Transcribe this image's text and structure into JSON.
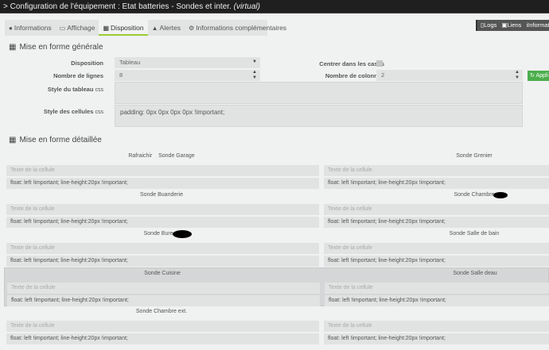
{
  "title": {
    "text": "Configuration de l'équipement : Etat batteries - Sondes et inter.",
    "suffix": "(virtual)"
  },
  "tabs": [
    {
      "label": "Informations",
      "icon": "info-circle-icon"
    },
    {
      "label": "Affichage",
      "icon": "monitor-icon"
    },
    {
      "label": "Disposition",
      "icon": "grid-icon"
    },
    {
      "label": "Alertes",
      "icon": "warning-icon"
    },
    {
      "label": "Informations complémentaires",
      "icon": "cogs-icon"
    }
  ],
  "top_buttons": [
    {
      "label": "Logs",
      "icon": "file-icon"
    },
    {
      "label": "Liens",
      "icon": "links-icon"
    },
    {
      "label": "Informat",
      "icon": "info-icon"
    }
  ],
  "general": {
    "heading": "Mise en forme générale",
    "disposition_label": "Disposition",
    "disposition_value": "Tableau",
    "lines_label": "Nombre de lignes",
    "lines_value": "8",
    "table_style_label": "Style du tableau",
    "css": "css",
    "table_style_value": "",
    "cell_style_label": "Style des cellules",
    "cell_style_value": "padding: 0px 0px 0px 0px !important;",
    "center_label": "Centrer dans les cases",
    "columns_label": "Nombre de colonnes",
    "columns_value": "2",
    "apply_label": "Appli"
  },
  "detail": {
    "heading": "Mise en forme détaillée",
    "placeholder": "Texte de la cellule",
    "style": "float: left !important; line-height:20px !important;",
    "rows": [
      {
        "left": "Rafraichir    Sonde Garage",
        "right": "Sonde Grenier"
      },
      {
        "left": "Sonde Buanderie",
        "right": "Sonde Chambre"
      },
      {
        "left": "Sonde Bureau",
        "right": "Sonde Salle de bain"
      },
      {
        "left": "Sonde Cuisine",
        "right": "Sonde Salle deau"
      },
      {
        "left": "Sonde Chambre ext.",
        "right": ""
      }
    ]
  }
}
